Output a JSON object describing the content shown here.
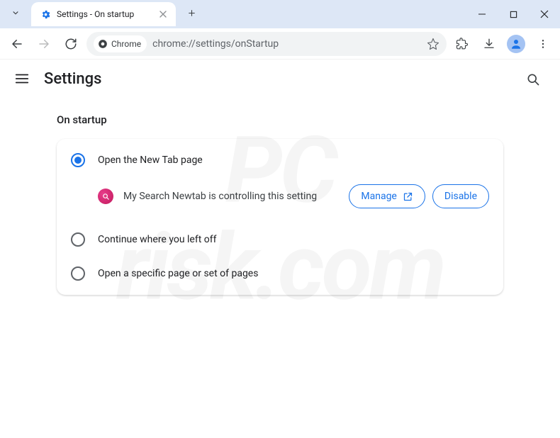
{
  "titlebar": {
    "tab_title": "Settings - On startup"
  },
  "toolbar": {
    "chip_label": "Chrome",
    "url": "chrome://settings/onStartup"
  },
  "settings_header": {
    "title": "Settings"
  },
  "content": {
    "section_title": "On startup",
    "options": [
      {
        "label": "Open the New Tab page"
      },
      {
        "label": "Continue where you left off"
      },
      {
        "label": "Open a specific page or set of pages"
      }
    ],
    "extension_notice": {
      "text": "My Search Newtab is controlling this setting",
      "manage_label": "Manage",
      "disable_label": "Disable"
    }
  },
  "watermark": {
    "line1": "PC",
    "line2": "risk.com"
  }
}
